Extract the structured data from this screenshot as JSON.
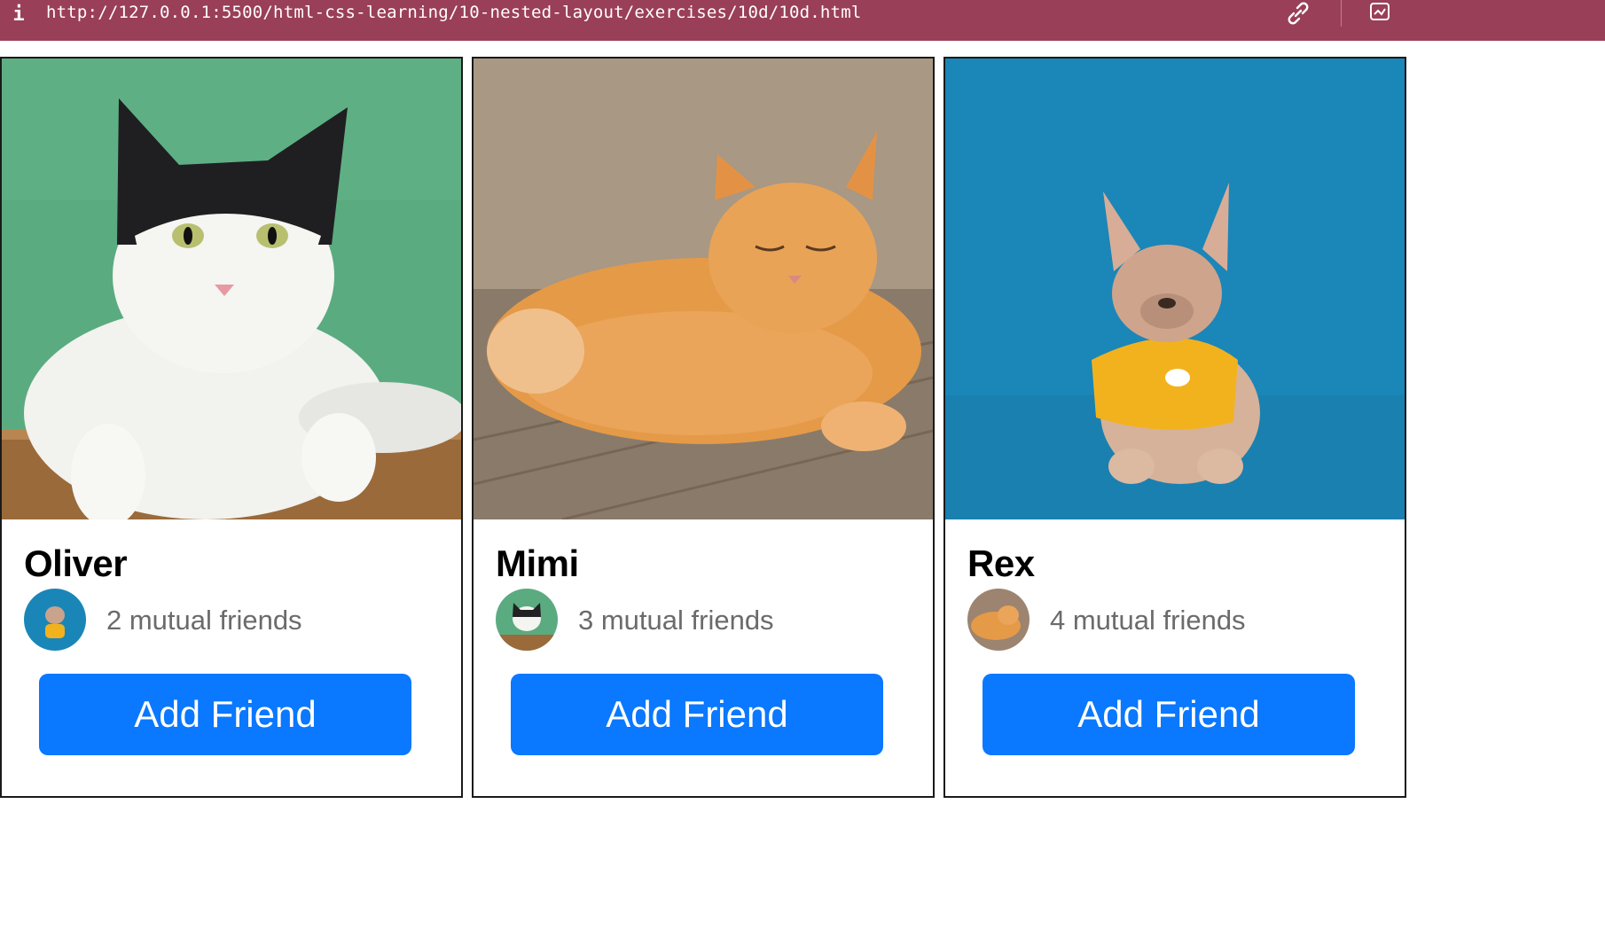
{
  "browser": {
    "info_glyph": "i",
    "url": "http://127.0.0.1:5500/html-css-learning/10-nested-layout/exercises/10d/10d.html"
  },
  "cards": [
    {
      "name": "Oliver",
      "mutual": "2 mutual friends",
      "button": "Add Friend"
    },
    {
      "name": "Mimi",
      "mutual": "3 mutual friends",
      "button": "Add Friend"
    },
    {
      "name": "Rex",
      "mutual": "4 mutual friends",
      "button": "Add Friend"
    }
  ],
  "colors": {
    "address_bar": "#9a3f58",
    "button": "#0a78ff",
    "muted_text": "#6b6b6b"
  },
  "icons": [
    "info-icon",
    "link-icon",
    "extension-icon"
  ]
}
